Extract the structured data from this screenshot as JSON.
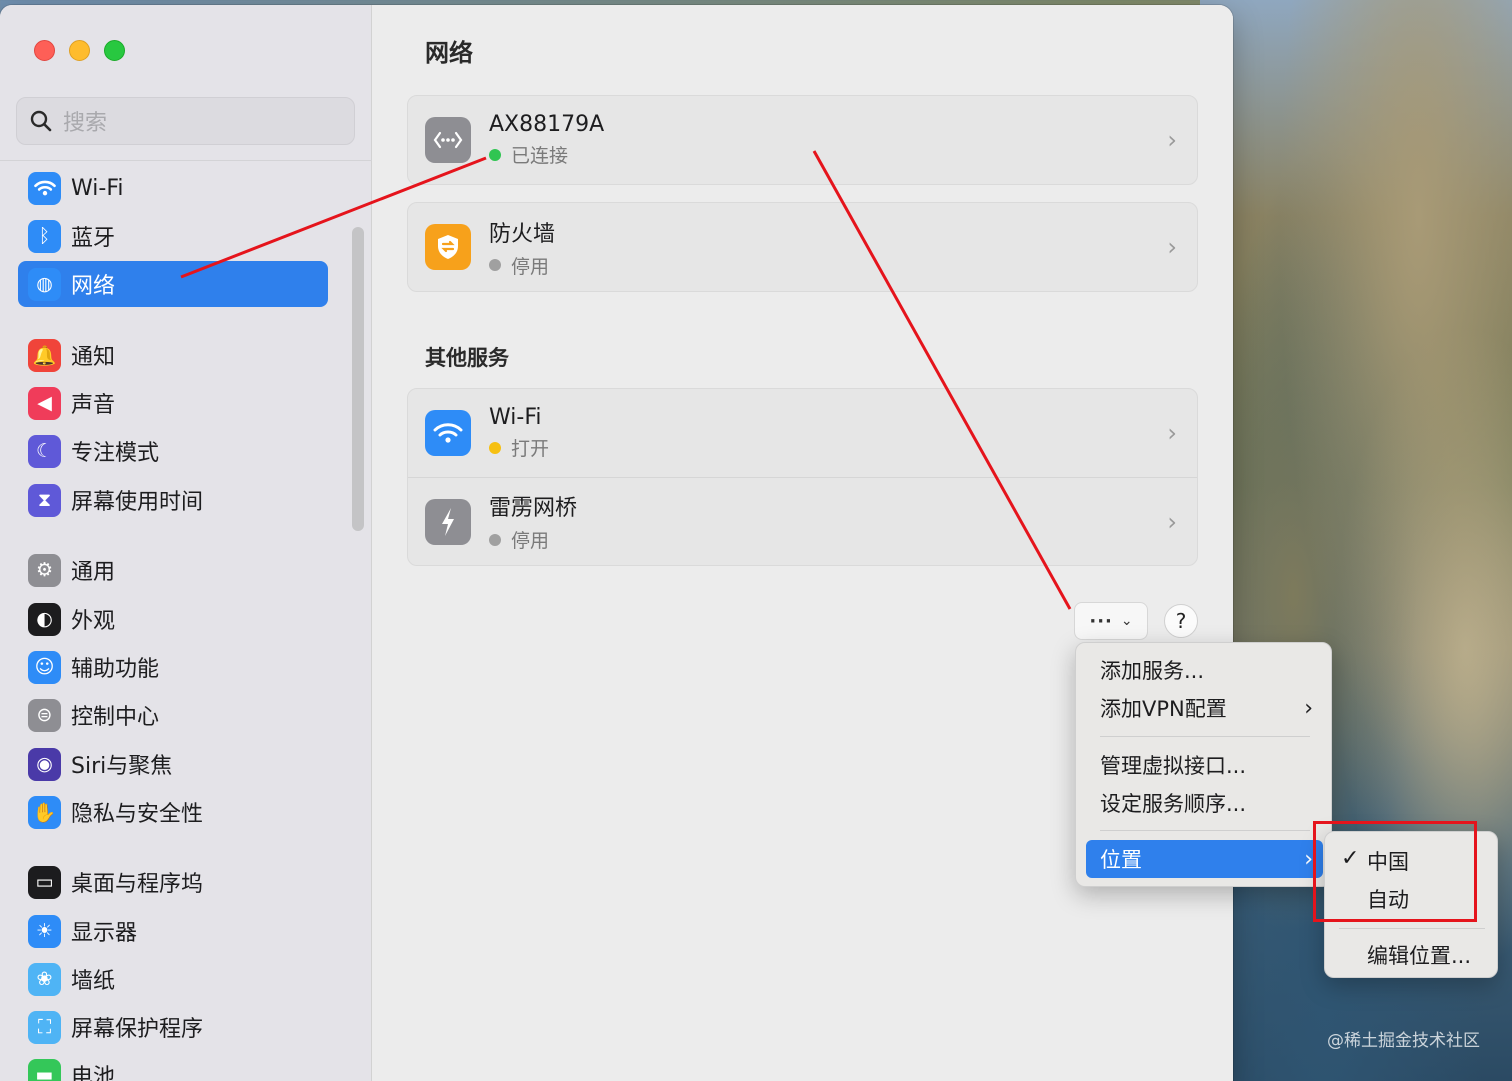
{
  "window": {
    "title": "网络",
    "search_placeholder": "搜索"
  },
  "sidebar": {
    "items": [
      {
        "label": "Wi-Fi",
        "icon": "wifi-icon",
        "color": "#2e8cf7"
      },
      {
        "label": "蓝牙",
        "icon": "bluetooth-icon",
        "color": "#2e8cf7"
      },
      {
        "label": "网络",
        "icon": "globe-icon",
        "color": "#2e8cf7",
        "active": true
      },
      {
        "label": "通知",
        "icon": "bell-icon",
        "color": "#f0443a"
      },
      {
        "label": "声音",
        "icon": "speaker-icon",
        "color": "#f03c5a"
      },
      {
        "label": "专注模式",
        "icon": "moon-icon",
        "color": "#5f59d8"
      },
      {
        "label": "屏幕使用时间",
        "icon": "hourglass-icon",
        "color": "#5f59d8"
      },
      {
        "label": "通用",
        "icon": "gear-icon",
        "color": "#8e8e93"
      },
      {
        "label": "外观",
        "icon": "appearance-icon",
        "color": "#1c1c1e"
      },
      {
        "label": "辅助功能",
        "icon": "accessibility-icon",
        "color": "#2e8cf7"
      },
      {
        "label": "控制中心",
        "icon": "toggles-icon",
        "color": "#8e8e93"
      },
      {
        "label": "Siri与聚焦",
        "icon": "siri-icon",
        "color": "#4a3aa8"
      },
      {
        "label": "隐私与安全性",
        "icon": "hand-icon",
        "color": "#2e8cf7"
      },
      {
        "label": "桌面与程序坞",
        "icon": "dock-icon",
        "color": "#1c1c1e"
      },
      {
        "label": "显示器",
        "icon": "sun-icon",
        "color": "#2e8cf7"
      },
      {
        "label": "墙纸",
        "icon": "flower-icon",
        "color": "#4fb4f5"
      },
      {
        "label": "屏幕保护程序",
        "icon": "screensaver-icon",
        "color": "#4fb4f5"
      },
      {
        "label": "电池",
        "icon": "battery-icon",
        "color": "#34c759"
      }
    ]
  },
  "main": {
    "primary_services": [
      {
        "name": "AX88179A",
        "status": "已连接",
        "status_color": "#30c552",
        "icon": "ethernet-icon"
      },
      {
        "name": "防火墙",
        "status": "停用",
        "status_color": "#a0a0a0",
        "icon": "firewall-icon"
      }
    ],
    "other_services_title": "其他服务",
    "other_services": [
      {
        "name": "Wi-Fi",
        "status": "打开",
        "status_color": "#f6c012",
        "icon": "wifi-icon"
      },
      {
        "name": "雷雳网桥",
        "status": "停用",
        "status_color": "#a0a0a0",
        "icon": "thunderbolt-icon"
      }
    ],
    "more_button": "···",
    "help_button": "?"
  },
  "menu": {
    "items": [
      "添加服务...",
      "添加VPN配置",
      "管理虚拟接口...",
      "设定服务顺序...",
      "位置"
    ]
  },
  "location_submenu": {
    "items": [
      "中国",
      "自动",
      "编辑位置..."
    ],
    "checked": "中国"
  },
  "watermark": "@稀土掘金技术社区",
  "annotation_color": "#e5141c"
}
